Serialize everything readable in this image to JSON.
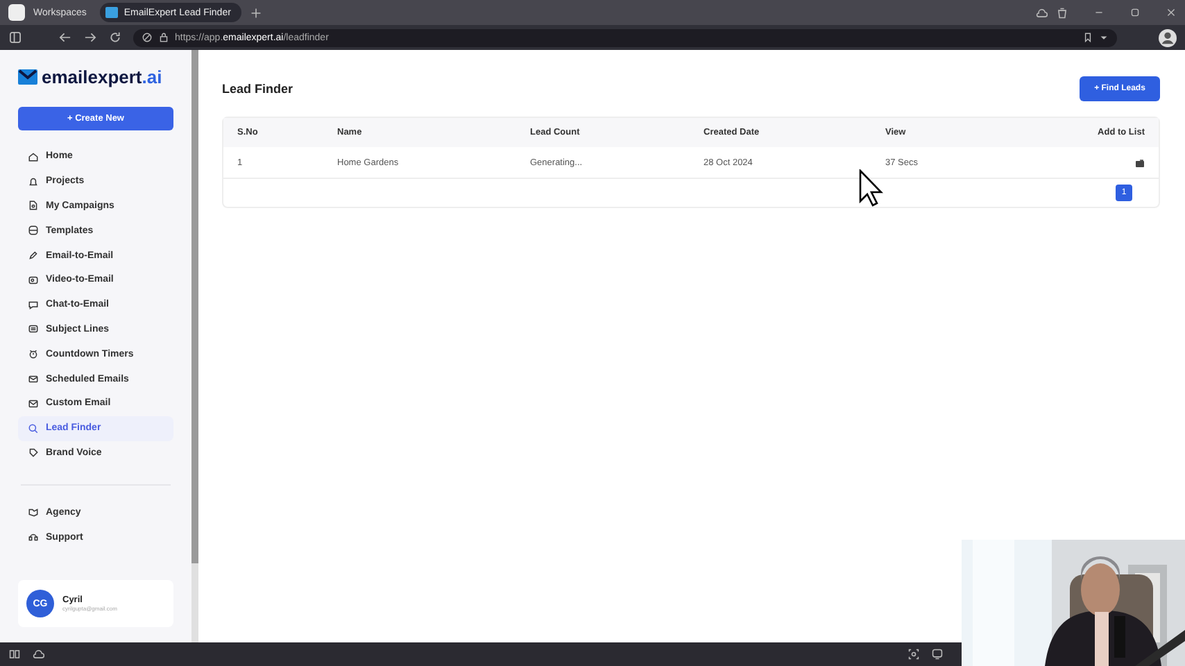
{
  "browser": {
    "workspaces": "Workspaces",
    "tab": {
      "title": "EmailExpert Lead Finder",
      "selected": true
    },
    "url": {
      "prefix": "https://app.",
      "domain": "emailexpert.ai",
      "path": "/leadfinder"
    }
  },
  "sidebar": {
    "logo": {
      "name": "emailexpert",
      "suffix": ".ai"
    },
    "create_button": "+ Create New",
    "items": [
      {
        "label": "Home",
        "selected": false
      },
      {
        "label": "Projects",
        "selected": false
      },
      {
        "label": "My Campaigns",
        "selected": false
      },
      {
        "label": "Templates",
        "selected": false
      },
      {
        "label": "Email-to-Email",
        "selected": false
      },
      {
        "label": "Video-to-Email",
        "selected": false
      },
      {
        "label": "Chat-to-Email",
        "selected": false
      },
      {
        "label": "Subject Lines",
        "selected": false
      },
      {
        "label": "Countdown Timers",
        "selected": false
      },
      {
        "label": "Scheduled Emails",
        "selected": false
      },
      {
        "label": "Custom Email",
        "selected": false
      },
      {
        "label": "Lead Finder",
        "selected": true
      },
      {
        "label": "Brand Voice",
        "selected": false
      }
    ],
    "footer_items": [
      {
        "label": "Agency",
        "selected": false
      },
      {
        "label": "Support",
        "selected": false
      }
    ],
    "user": {
      "initials": "CG",
      "name": "Cyril",
      "email": "cyrilgupta@gmail.com"
    }
  },
  "main": {
    "title": "Lead Finder",
    "find_button": "+ Find Leads",
    "table": {
      "columns": [
        "S.No",
        "Name",
        "Lead Count",
        "Created Date",
        "View",
        "Add to List"
      ],
      "rows": [
        {
          "cells": [
            "1",
            "Home Gardens",
            "Generating...",
            "28 Oct 2024",
            "37 Secs"
          ]
        }
      ]
    },
    "pagination": [
      {
        "label": "1",
        "selected": true
      }
    ]
  }
}
